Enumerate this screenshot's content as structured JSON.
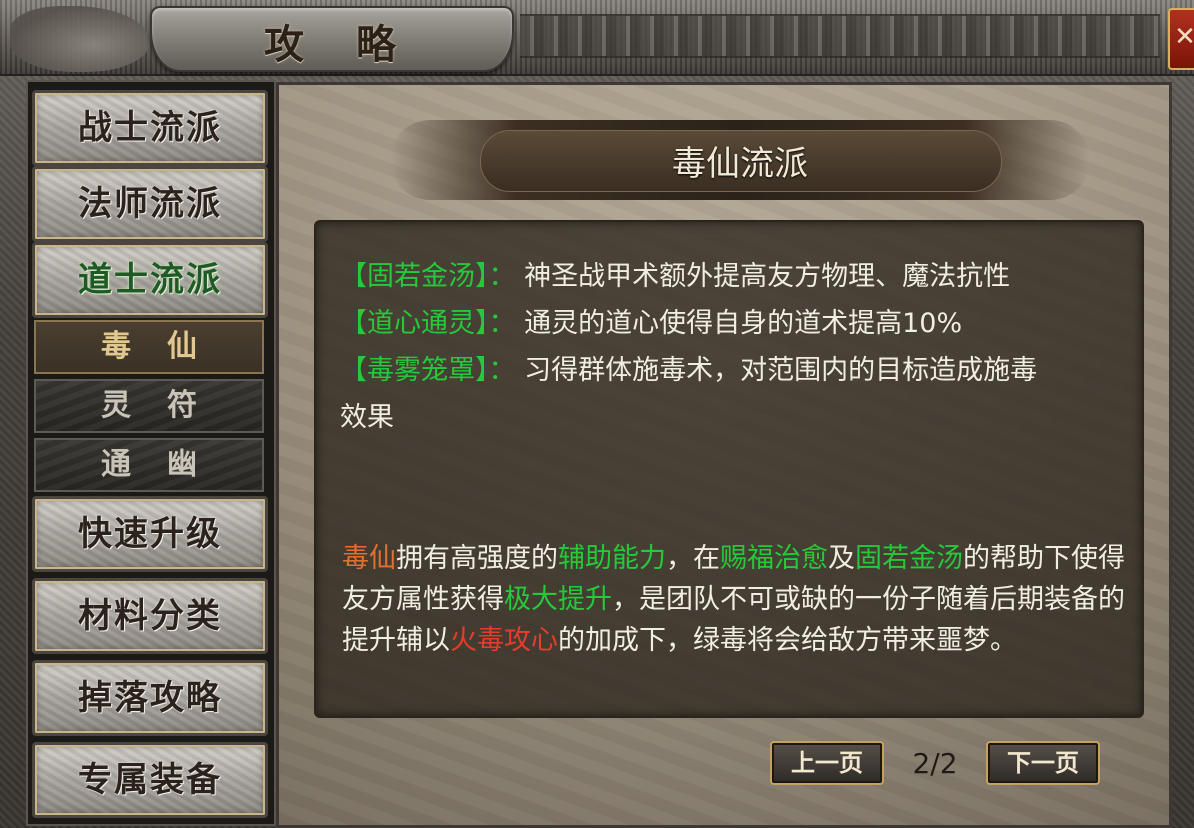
{
  "window": {
    "title": "攻略",
    "close_glyph": "✕"
  },
  "sidebar": {
    "categories": [
      {
        "label": "战士流派",
        "active": false
      },
      {
        "label": "法师流派",
        "active": false
      },
      {
        "label": "道士流派",
        "active": true
      }
    ],
    "sub_items": [
      {
        "label": "毒仙",
        "active": true
      },
      {
        "label": "灵符",
        "active": false
      },
      {
        "label": "通幽",
        "active": false
      }
    ],
    "more_categories": [
      {
        "label": "快速升级"
      },
      {
        "label": "材料分类"
      },
      {
        "label": "掉落攻略"
      },
      {
        "label": "专属装备"
      }
    ]
  },
  "main": {
    "banner_title": "毒仙流派",
    "skills": [
      {
        "name": "【固若金汤】",
        "sep": "：",
        "desc": "神圣战甲术额外提高友方物理、魔法抗性"
      },
      {
        "name": "【道心通灵】",
        "sep": "：",
        "desc": "通灵的道心使得自身的道术提高10%"
      },
      {
        "name": "【毒雾笼罩】",
        "sep": "：",
        "desc": "习得群体施毒术，对范围内的目标造成施毒",
        "desc_cont": "效果"
      }
    ],
    "paragraph": [
      {
        "text": "毒仙",
        "color": "orange"
      },
      {
        "text": "拥有高强度的",
        "color": "white"
      },
      {
        "text": "辅助能力",
        "color": "green"
      },
      {
        "text": "，在",
        "color": "white"
      },
      {
        "text": "赐福治愈",
        "color": "green"
      },
      {
        "text": "及",
        "color": "white"
      },
      {
        "text": "固若金汤",
        "color": "green"
      },
      {
        "text": "的帮助下使得友方属性获得",
        "color": "white"
      },
      {
        "text": "极大提升",
        "color": "green"
      },
      {
        "text": "，是团队不可或缺的一份子随着后期装备的提升辅以",
        "color": "white"
      },
      {
        "text": "火毒攻心",
        "color": "red"
      },
      {
        "text": "的加成下，绿毒将会给敌方带来噩梦。",
        "color": "white"
      }
    ]
  },
  "pager": {
    "prev_label": "上一页",
    "next_label": "下一页",
    "page_text": "2/2"
  },
  "colors": {
    "green_highlight": "#25c93a",
    "orange_highlight": "#e2702e",
    "red_highlight": "#e43d2a",
    "body_text": "#f2ede2"
  }
}
